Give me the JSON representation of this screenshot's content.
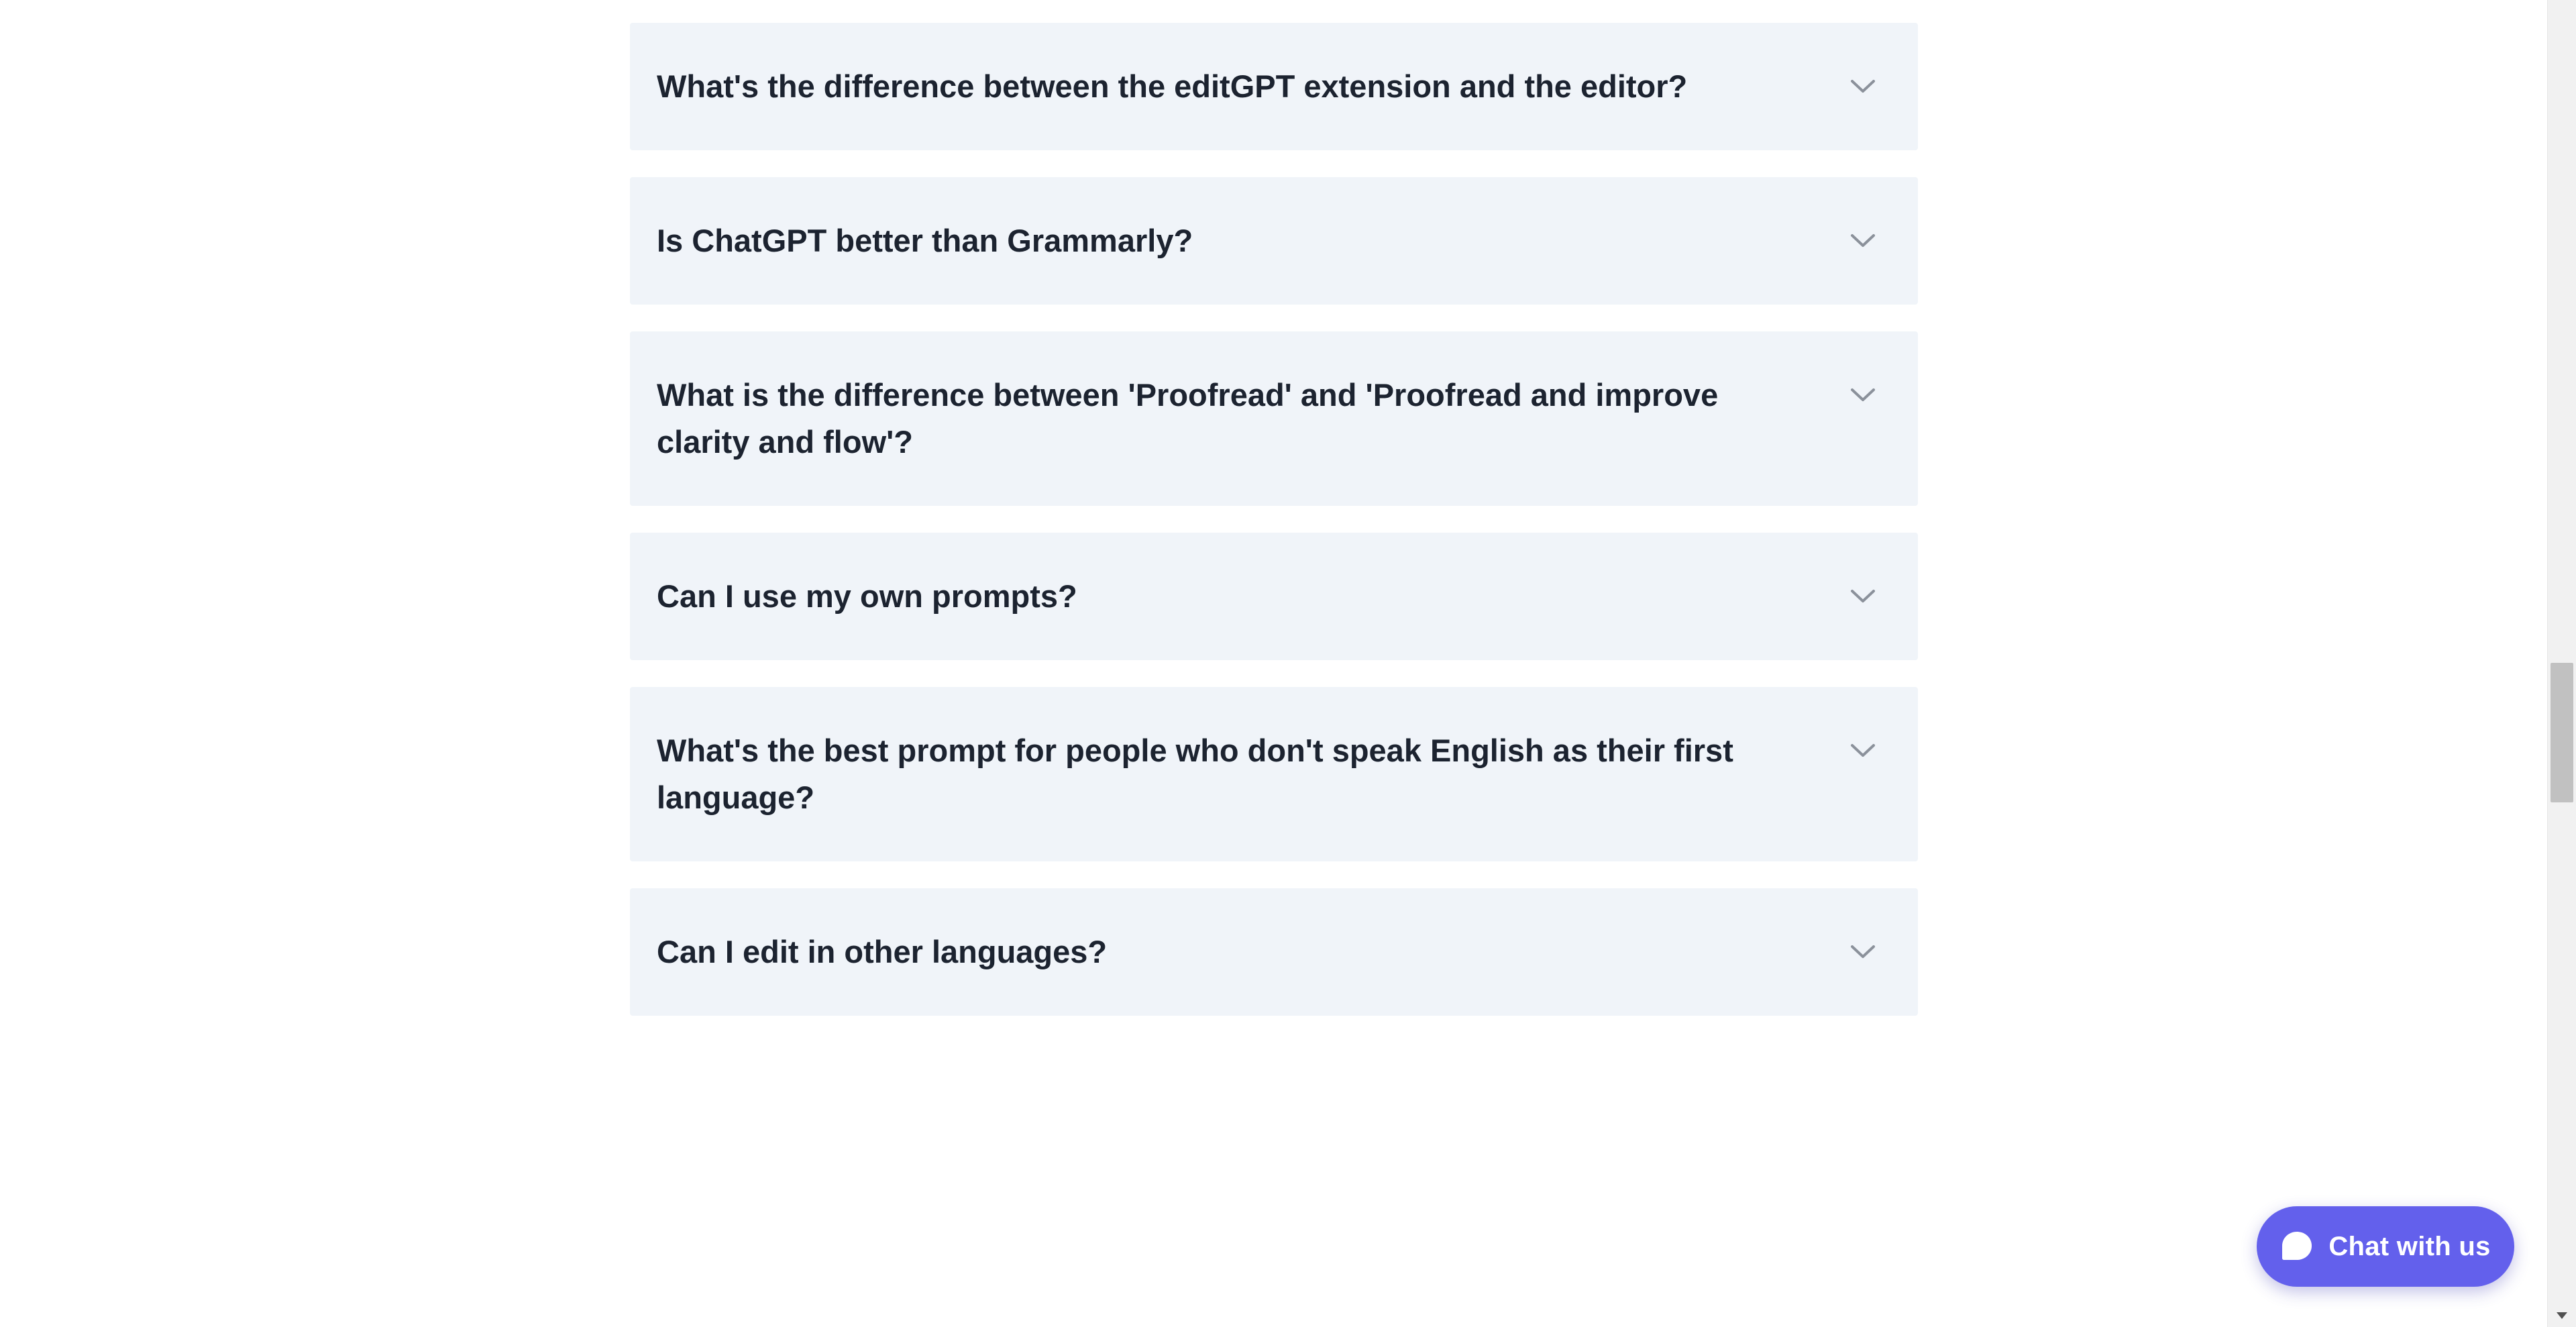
{
  "faq": {
    "items": [
      {
        "question": "What's the difference between the editGPT extension and the editor?"
      },
      {
        "question": "Is ChatGPT better than Grammarly?"
      },
      {
        "question": "What is the difference between 'Proofread' and 'Proofread and improve clarity and flow'?"
      },
      {
        "question": "Can I use my own prompts?"
      },
      {
        "question": "What's the best prompt for people who don't speak English as their first language?"
      },
      {
        "question": "Can I edit in other languages?"
      }
    ],
    "chevron_icon": "chevron-down-icon"
  },
  "chat": {
    "label": "Chat with us",
    "icon": "chat-bubble-icon",
    "color": "#6360ec"
  },
  "colors": {
    "item_background": "#f0f4f9",
    "question_text": "#1c2330",
    "chevron": "#8b919b"
  }
}
